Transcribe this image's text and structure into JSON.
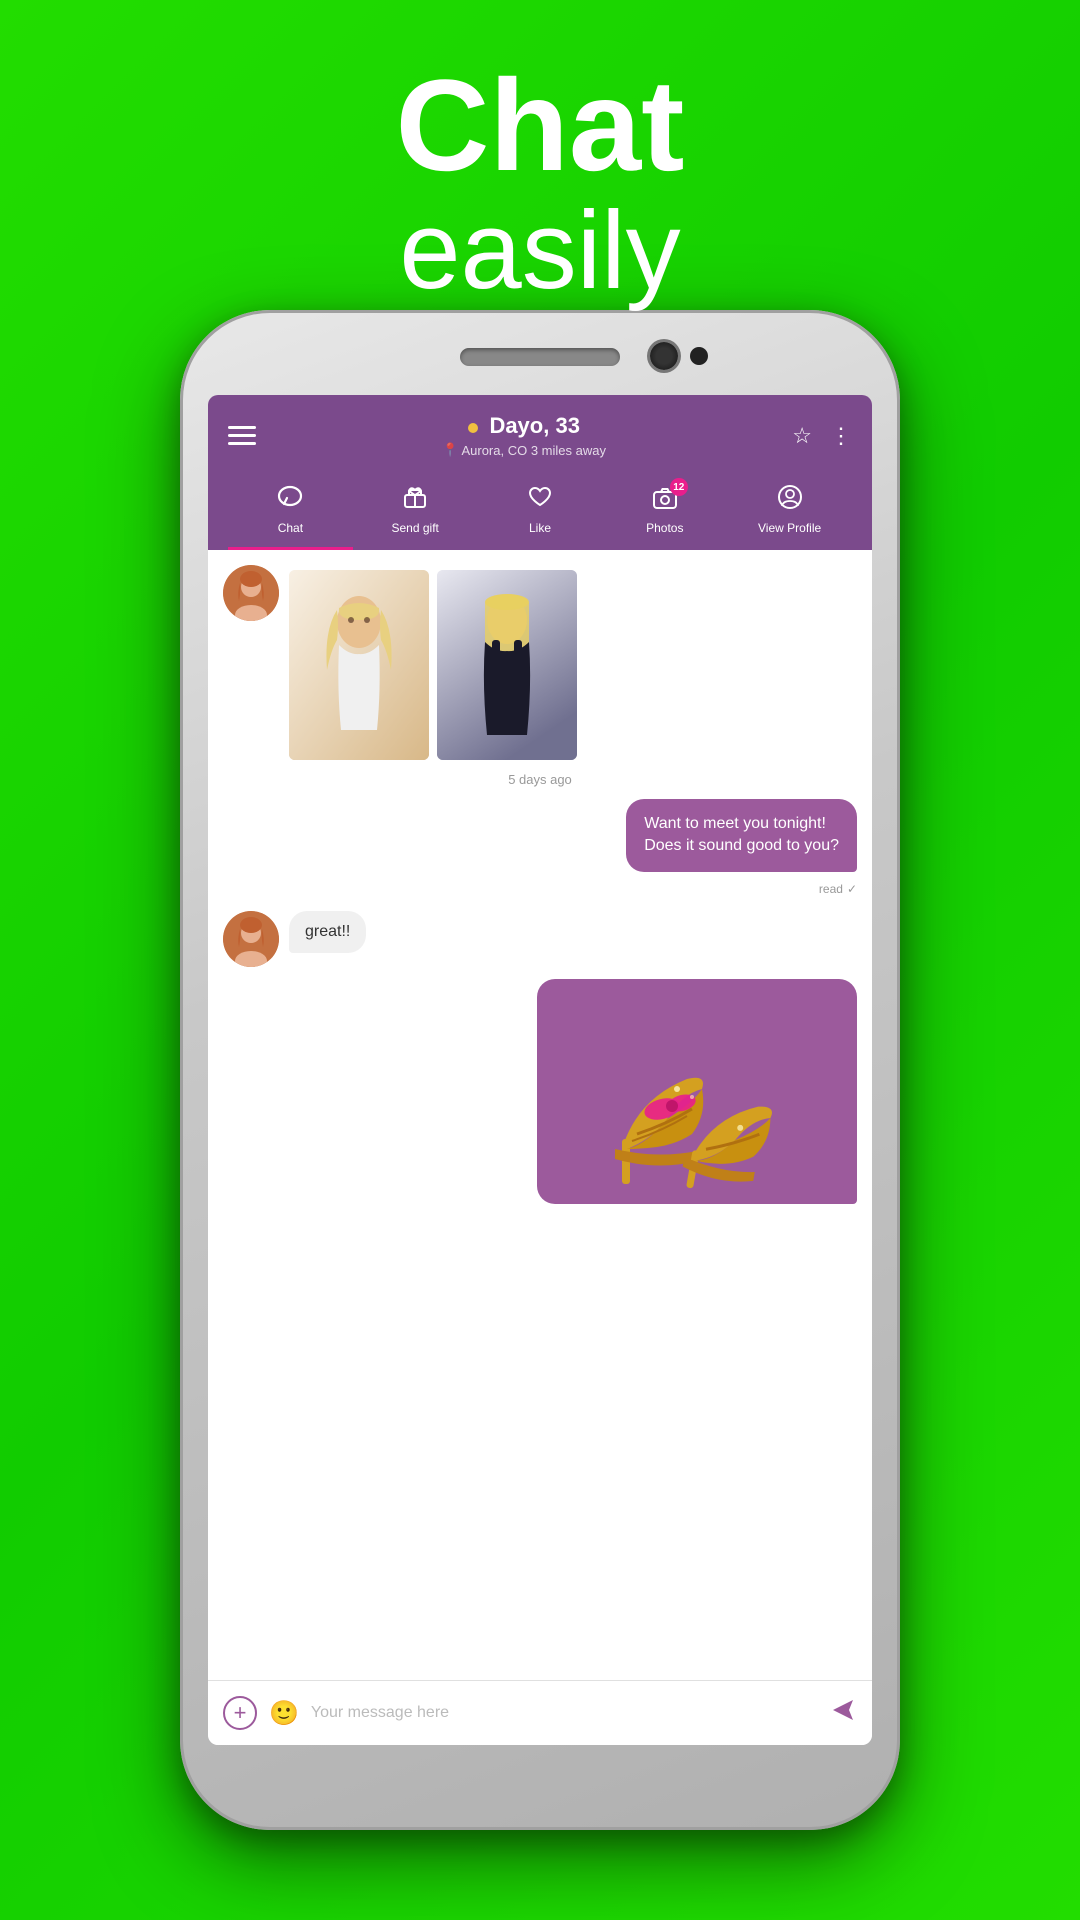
{
  "page": {
    "background_color": "#22cc00",
    "headline": {
      "chat": "Chat",
      "easily": "easily"
    }
  },
  "app": {
    "header": {
      "hamburger_label": "menu",
      "name": "Dayo, 33",
      "online_indicator": "online",
      "location": "Aurora, CO  3 miles away",
      "star_label": "favorite",
      "more_label": "more options"
    },
    "nav": {
      "tabs": [
        {
          "id": "chat",
          "label": "Chat",
          "icon": "chat-bubble",
          "active": true,
          "badge": null
        },
        {
          "id": "send-gift",
          "label": "Send gift",
          "icon": "gift-box",
          "active": false,
          "badge": null
        },
        {
          "id": "like",
          "label": "Like",
          "icon": "heart",
          "active": false,
          "badge": null
        },
        {
          "id": "photos",
          "label": "Photos",
          "icon": "camera",
          "active": false,
          "badge": "12"
        },
        {
          "id": "view-profile",
          "label": "View Profile",
          "icon": "person-circle",
          "active": false,
          "badge": null
        }
      ]
    },
    "messages": [
      {
        "type": "photo-thumbnails",
        "sender": "other",
        "avatar": true,
        "photos": [
          "photo1",
          "photo2"
        ]
      },
      {
        "type": "timestamp",
        "text": "5 days ago"
      },
      {
        "type": "text",
        "sender": "me",
        "text": "Want to meet you tonight!\nDoes it sound good to you?"
      },
      {
        "type": "read-status",
        "text": "read"
      },
      {
        "type": "text",
        "sender": "other",
        "avatar": true,
        "text": "great!!"
      },
      {
        "type": "image",
        "sender": "me",
        "description": "gift shoes image"
      }
    ],
    "input": {
      "placeholder": "Your message here",
      "add_label": "+",
      "emoji_label": "emoji",
      "send_label": "send"
    }
  }
}
